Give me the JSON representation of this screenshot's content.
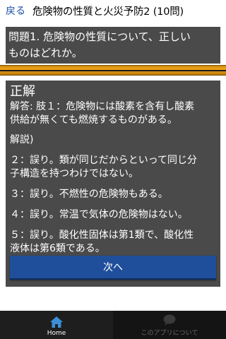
{
  "header": {
    "back_label": "戻る",
    "title": "危険物の性質と火災予防2 (10問)"
  },
  "question": {
    "text_line1": "問題1. 危険物の性質について、正しい",
    "text_line2": "ものはどれか。"
  },
  "answer": {
    "result": "正解",
    "answer_line1": "解答: 肢１：危険物には酸素を含有し酸素",
    "answer_line2": "供給が無くても燃焼するものがある。",
    "explain_head": "解説)",
    "items": [
      {
        "line1": "２：誤り。類が同じだからといって同じ分",
        "line2": "子構造を持つわけではない。"
      },
      {
        "line1": "３：誤り。不燃性の危険物もある。",
        "line2": ""
      },
      {
        "line1": "４：誤り。常温で気体の危険物はない。",
        "line2": ""
      },
      {
        "line1": "５：誤り。酸化性固体は第1類で、酸化性",
        "line2": "液体は第6類である。"
      }
    ]
  },
  "next_button": {
    "label": "次へ"
  },
  "bottom_nav": {
    "home_label": "Home",
    "about_label": "このアプリについて"
  },
  "colors": {
    "accent": "#1f4f9a",
    "divider": "#f4a516",
    "panel": "#4a4a4a",
    "home_icon": "#3a8fd6"
  },
  "icons": {
    "home": "home-icon",
    "about": "speech-bubble-icon"
  }
}
